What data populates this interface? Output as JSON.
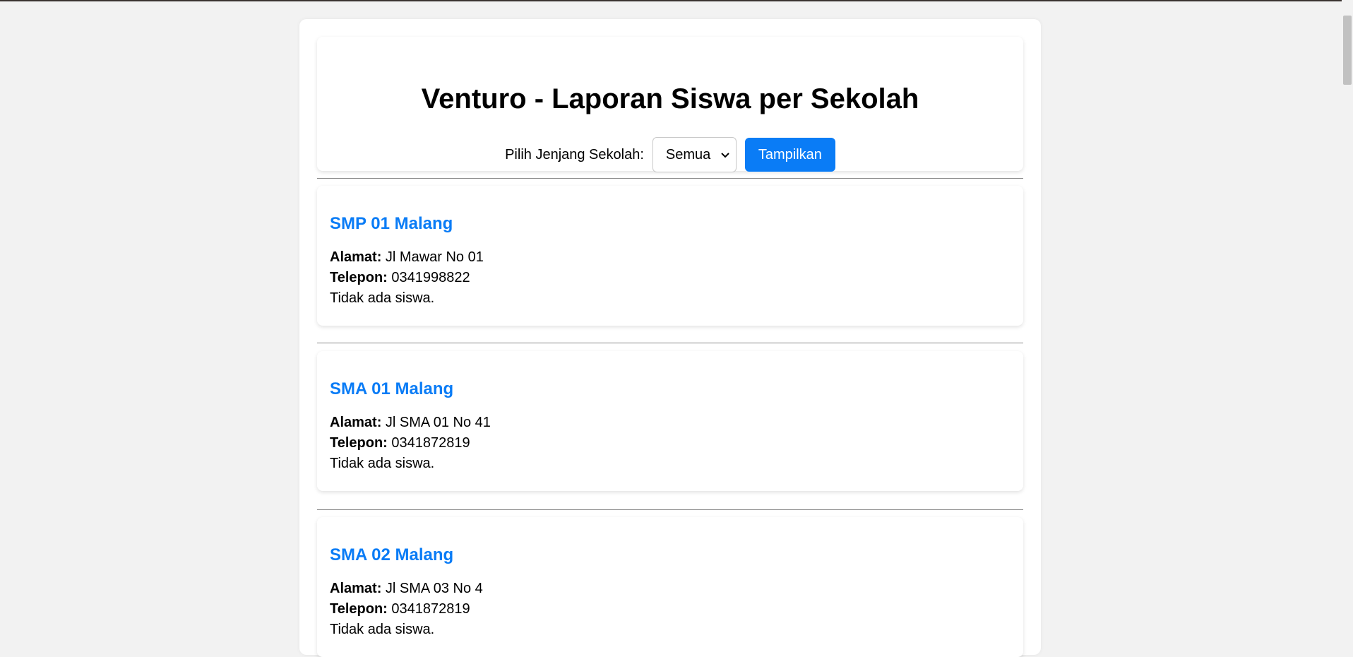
{
  "header": {
    "title": "Venturo - Laporan Siswa per Sekolah",
    "filter_label": "Pilih Jenjang Sekolah:",
    "select_value": "Semua",
    "button_label": "Tampilkan"
  },
  "labels": {
    "alamat": "Alamat:",
    "telepon": "Telepon:"
  },
  "schools": [
    {
      "name": "SMP 01 Malang",
      "alamat": "Jl Mawar No 01",
      "telepon": "0341998822",
      "status": "Tidak ada siswa."
    },
    {
      "name": "SMA 01 Malang",
      "alamat": "Jl SMA 01 No 41",
      "telepon": "0341872819",
      "status": "Tidak ada siswa."
    },
    {
      "name": "SMA 02 Malang",
      "alamat": "Jl SMA 03 No 4",
      "telepon": "0341872819",
      "status": "Tidak ada siswa."
    }
  ],
  "colors": {
    "accent": "#0a7cf6",
    "background": "#f2f2f2"
  },
  "icons": {
    "select_arrow": "chevron-down-icon"
  }
}
